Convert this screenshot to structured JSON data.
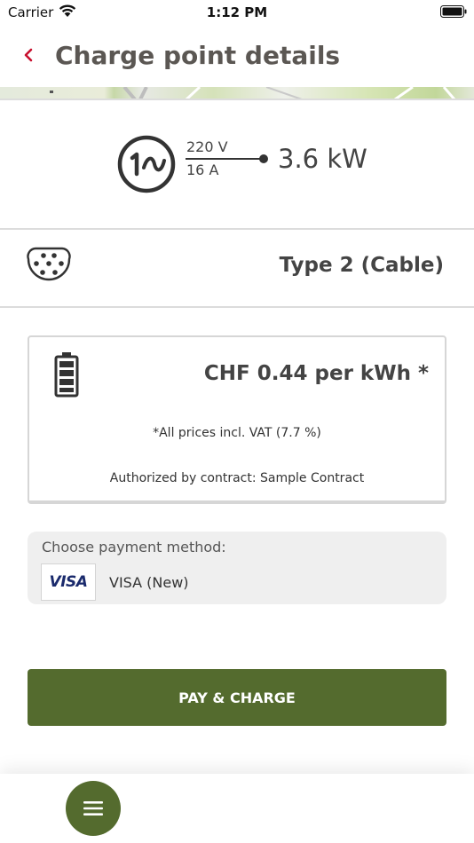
{
  "status_bar": {
    "carrier": "Carrier",
    "time": "1:12 PM"
  },
  "header": {
    "title": "Charge point details",
    "back_icon": "chevron-left-icon"
  },
  "power": {
    "phase_label": "1~",
    "voltage": "220 V",
    "current": "16 A",
    "power": "3.6 kW"
  },
  "connector": {
    "label": "Type 2 (Cable)",
    "icon": "type2-connector-icon"
  },
  "tariff": {
    "price": "CHF 0.44 per kWh *",
    "vat_note": "*All prices incl. VAT (7.7 %)",
    "contract_note": "Authorized by contract: Sample Contract",
    "icon": "battery-full-icon"
  },
  "payment": {
    "label": "Choose payment method:",
    "card_brand": "VISA",
    "method": "VISA (New)"
  },
  "pay_button": {
    "label": "PAY & CHARGE"
  },
  "colors": {
    "brand_green": "#546b2e",
    "back_red": "#c8102e",
    "text_dark": "#444444"
  }
}
